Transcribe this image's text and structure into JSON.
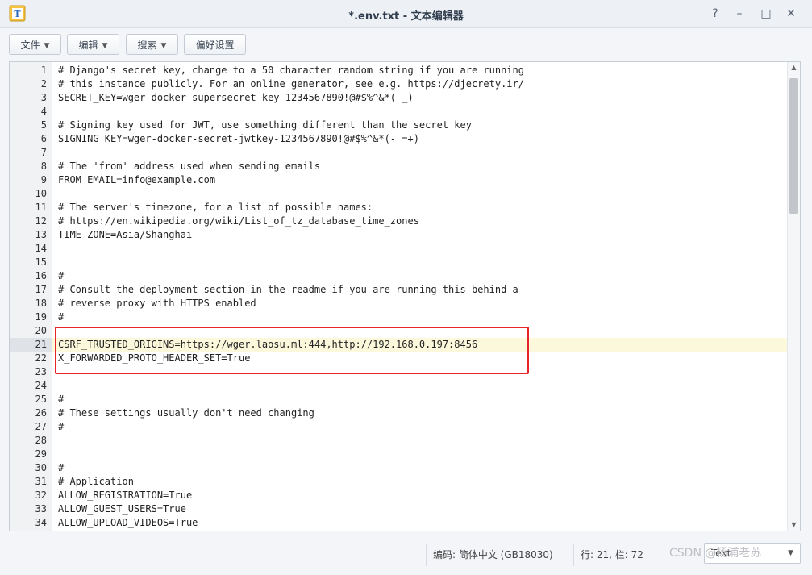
{
  "window": {
    "title": "*.env.txt - 文本编辑器",
    "help_label": "?",
    "minimize_label": "–",
    "maximize_label": "□",
    "close_label": "✕"
  },
  "toolbar": {
    "file_label": "文件",
    "edit_label": "编辑",
    "search_label": "搜索",
    "prefs_label": "偏好设置"
  },
  "editor": {
    "current_line": 21,
    "lines": [
      {
        "n": "1",
        "text": "# Django's secret key, change to a 50 character random string if you are running"
      },
      {
        "n": "2",
        "text": "# this instance publicly. For an online generator, see e.g. https://djecrety.ir/"
      },
      {
        "n": "3",
        "text": "SECRET_KEY=wger-docker-supersecret-key-1234567890!@#$%^&*(-_)"
      },
      {
        "n": "4",
        "text": ""
      },
      {
        "n": "5",
        "text": "# Signing key used for JWT, use something different than the secret key"
      },
      {
        "n": "6",
        "text": "SIGNING_KEY=wger-docker-secret-jwtkey-1234567890!@#$%^&*(-_=+)"
      },
      {
        "n": "7",
        "text": ""
      },
      {
        "n": "8",
        "text": "# The 'from' address used when sending emails"
      },
      {
        "n": "9",
        "text": "FROM_EMAIL=info@example.com"
      },
      {
        "n": "10",
        "text": ""
      },
      {
        "n": "11",
        "text": "# The server's timezone, for a list of possible names:"
      },
      {
        "n": "12",
        "text": "# https://en.wikipedia.org/wiki/List_of_tz_database_time_zones"
      },
      {
        "n": "13",
        "text": "TIME_ZONE=Asia/Shanghai"
      },
      {
        "n": "14",
        "text": ""
      },
      {
        "n": "15",
        "text": ""
      },
      {
        "n": "16",
        "text": "#"
      },
      {
        "n": "17",
        "text": "# Consult the deployment section in the readme if you are running this behind a"
      },
      {
        "n": "18",
        "text": "# reverse proxy with HTTPS enabled"
      },
      {
        "n": "19",
        "text": "#"
      },
      {
        "n": "20",
        "text": ""
      },
      {
        "n": "21",
        "text": "CSRF_TRUSTED_ORIGINS=https://wger.laosu.ml:444,http://192.168.0.197:8456"
      },
      {
        "n": "22",
        "text": "X_FORWARDED_PROTO_HEADER_SET=True"
      },
      {
        "n": "23",
        "text": ""
      },
      {
        "n": "24",
        "text": ""
      },
      {
        "n": "25",
        "text": "#"
      },
      {
        "n": "26",
        "text": "# These settings usually don't need changing"
      },
      {
        "n": "27",
        "text": "#"
      },
      {
        "n": "28",
        "text": ""
      },
      {
        "n": "29",
        "text": ""
      },
      {
        "n": "30",
        "text": "#"
      },
      {
        "n": "31",
        "text": "# Application"
      },
      {
        "n": "32",
        "text": "ALLOW_REGISTRATION=True"
      },
      {
        "n": "33",
        "text": "ALLOW_GUEST_USERS=True"
      },
      {
        "n": "34",
        "text": "ALLOW_UPLOAD_VIDEOS=True"
      }
    ]
  },
  "status": {
    "encoding": "编码: 简体中文 (GB18030)",
    "position": "行: 21, 栏: 72",
    "mode": "Text"
  },
  "watermark": "CSDN @杨浦老苏",
  "colors": {
    "highlight_border": "#e8232a",
    "current_line_bg": "#fcf8dc"
  }
}
